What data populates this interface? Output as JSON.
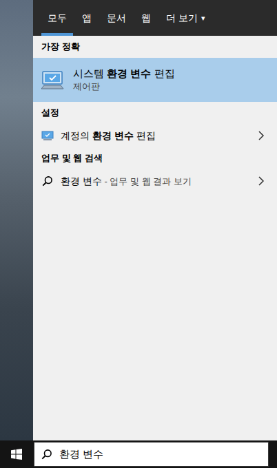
{
  "tabs": [
    {
      "label": "모두",
      "selected": true
    },
    {
      "label": "앱",
      "selected": false
    },
    {
      "label": "문서",
      "selected": false
    },
    {
      "label": "웹",
      "selected": false
    },
    {
      "label": "더 보기",
      "selected": false,
      "caret": "▾"
    }
  ],
  "sections": [
    {
      "title": "가장 정확",
      "items": [
        {
          "kind": "best",
          "selected": true,
          "title": [
            {
              "text": "시스템 ",
              "bold": false
            },
            {
              "text": "환경 변수",
              "bold": true
            },
            {
              "text": " 편집",
              "bold": false
            }
          ],
          "subtitle": "제어판"
        }
      ]
    },
    {
      "title": "설정",
      "items": [
        {
          "kind": "setting",
          "selected": false,
          "title": [
            {
              "text": "계정의 ",
              "bold": false
            },
            {
              "text": "환경 변수",
              "bold": true
            },
            {
              "text": " 편집",
              "bold": false
            }
          ]
        }
      ]
    },
    {
      "title": "업무 및 웹 검색",
      "items": [
        {
          "kind": "web",
          "selected": false,
          "title": [
            {
              "text": "환경 변수",
              "bold": false
            }
          ],
          "detail": " - 업무 및 웹 결과 보기"
        }
      ]
    }
  ],
  "search": {
    "value": "환경 변수"
  }
}
